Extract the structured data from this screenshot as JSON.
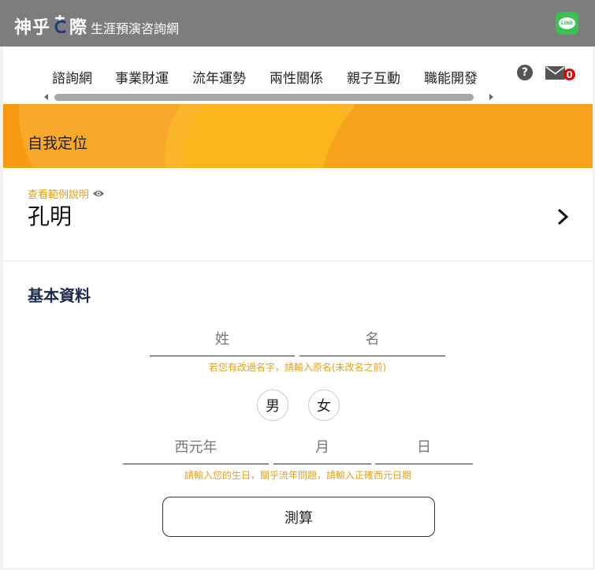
{
  "header": {
    "brand_main_1": "神乎",
    "brand_main_2": "際",
    "brand_sub": "生涯預演咨詢網",
    "line_label": "LINE",
    "background_color": "#7d7d7d"
  },
  "nav": {
    "items": [
      {
        "label": "諮詢網"
      },
      {
        "label": "事業財運"
      },
      {
        "label": "流年運勢"
      },
      {
        "label": "兩性關係"
      },
      {
        "label": "親子互動"
      },
      {
        "label": "職能開發"
      }
    ],
    "help_symbol": "?",
    "mail_count": "0",
    "icons": [
      "help-icon",
      "mail-icon"
    ]
  },
  "banner": {
    "title": "自我定位",
    "accent_color": "#f7a21c"
  },
  "profile": {
    "example_link": "查看範例說明",
    "name": "孔明",
    "icons": [
      "eye-icon",
      "chevron-right-icon"
    ]
  },
  "basic_info": {
    "title": "基本資料",
    "surname_placeholder": "姓",
    "given_name_placeholder": "名",
    "name_hint": "若您有改過名字，請輸入原名(未改名之前)",
    "male_label": "男",
    "female_label": "女",
    "year_placeholder": "西元年",
    "month_placeholder": "月",
    "day_placeholder": "日",
    "birth_hint": "請輸入您的生日，關乎流年問題，請輸入正確西元日期",
    "calculate_label": "測算"
  }
}
